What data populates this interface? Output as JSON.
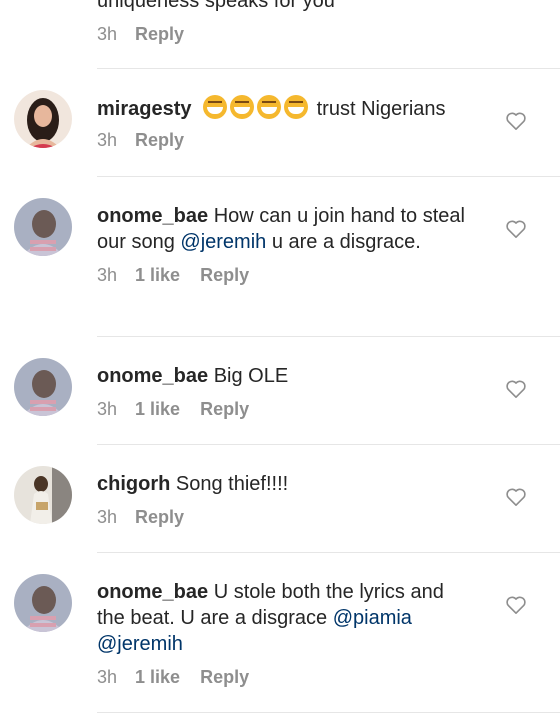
{
  "partial_comment": {
    "text": "uniqueness  speaks for you",
    "time": "3h",
    "reply": "Reply"
  },
  "comments": [
    {
      "username": "miragesty",
      "emojis": [
        "grinning-squinting-face",
        "grinning-squinting-face",
        "grinning-squinting-face",
        "grinning-squinting-face"
      ],
      "text_after": " trust Nigerians",
      "time": "3h",
      "reply": "Reply",
      "avatar_color": "#d9b8a6"
    },
    {
      "username": "onome_bae",
      "text": " How can u join hand to steal our song ",
      "mention": "@jeremih",
      "text_after": " u are a disgrace.",
      "time": "3h",
      "likes": "1 like",
      "reply": "Reply",
      "avatar_color": "#9aa3b6"
    },
    {
      "username": "onome_bae",
      "text": " Big OLE",
      "time": "3h",
      "likes": "1 like",
      "reply": "Reply",
      "avatar_color": "#9aa3b6"
    },
    {
      "username": "chigorh",
      "text": " Song thief!!!!",
      "time": "3h",
      "reply": "Reply",
      "avatar_color": "#c8b9a0"
    },
    {
      "username": "onome_bae",
      "text": " U stole both the lyrics and the beat. U are a disgrace ",
      "mention": "@piamia",
      "mention2": "@jeremih",
      "time": "3h",
      "likes": "1 like",
      "reply": "Reply",
      "avatar_color": "#9aa3b6"
    }
  ],
  "colors": {
    "text": "#262626",
    "meta": "#8e8e8e",
    "mention": "#003569",
    "divider": "#e6e6e6"
  }
}
